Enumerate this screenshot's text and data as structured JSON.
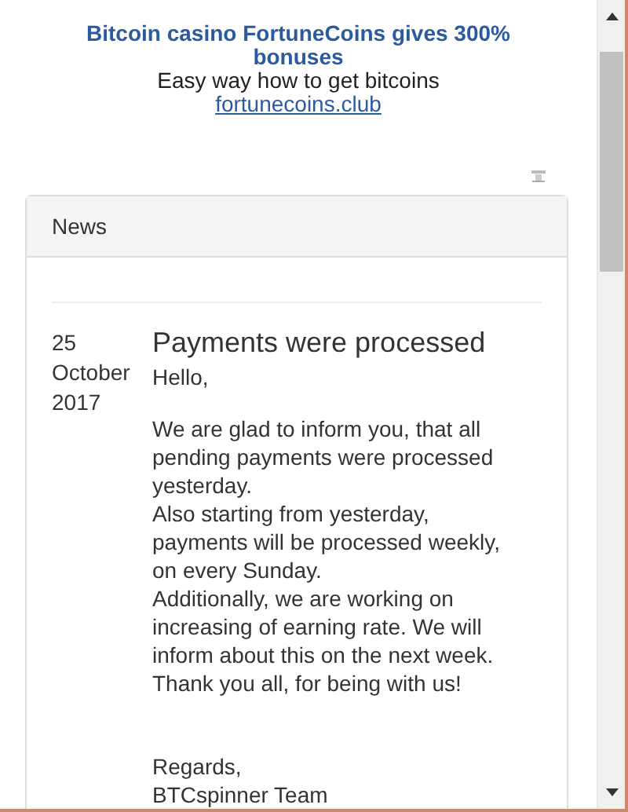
{
  "ad": {
    "title": "Bitcoin casino FortuneCoins gives 300% bonuses",
    "subtitle": "Easy way how to get bitcoins",
    "link": "fortunecoins.club"
  },
  "panel": {
    "heading": "News",
    "items": [
      {
        "day": "25",
        "month": "October",
        "year": "2017",
        "title": "Payments were processed",
        "greeting": "Hello,",
        "paragraphs": [
          "We are glad to inform you, that all pending payments were processed yesterday.",
          "Also starting from yesterday, payments will be processed weekly, on every Sunday.",
          "Additionally, we are working on increasing of earning rate. We will inform about this on the next week.",
          "Thank you all, for being with us!"
        ],
        "closing": "Regards,",
        "signature": "BTCspinner Team"
      }
    ]
  }
}
